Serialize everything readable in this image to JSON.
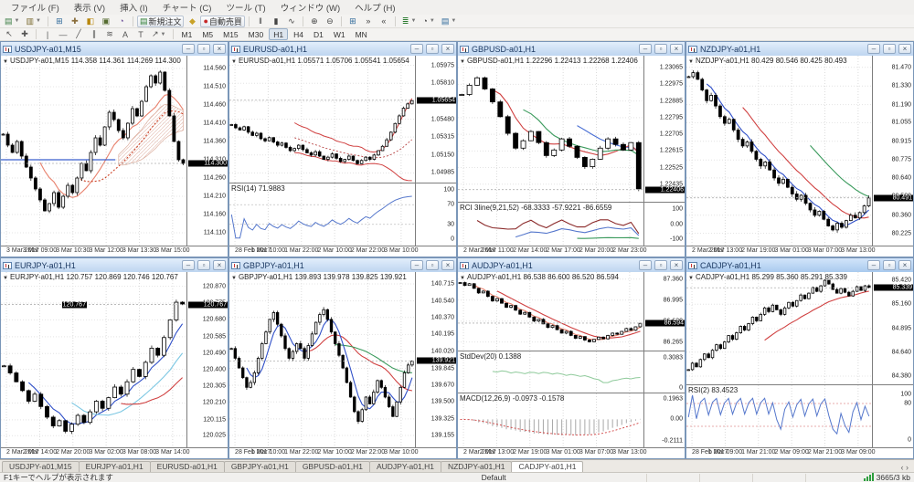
{
  "menu": [
    {
      "key": "file",
      "label": "ファイル (F)"
    },
    {
      "key": "view",
      "label": "表示 (V)"
    },
    {
      "key": "insert",
      "label": "挿入 (I)"
    },
    {
      "key": "chart",
      "label": "チャート (C)"
    },
    {
      "key": "tools",
      "label": "ツール (T)"
    },
    {
      "key": "window",
      "label": "ウィンドウ (W)"
    },
    {
      "key": "help",
      "label": "ヘルプ (H)"
    }
  ],
  "toolbar1": [
    {
      "name": "new-chart",
      "glyph": "▤",
      "dd": true,
      "color": "#3a7d44"
    },
    {
      "name": "profiles",
      "glyph": "▥",
      "dd": true,
      "color": "#7a6a2f"
    },
    {
      "sep": true
    },
    {
      "name": "market-watch",
      "glyph": "⊞",
      "color": "#2f6a9a"
    },
    {
      "name": "data-window",
      "glyph": "✚",
      "color": "#8a6d3b"
    },
    {
      "name": "navigator",
      "glyph": "◧",
      "color": "#b8860b"
    },
    {
      "name": "terminal",
      "glyph": "▣",
      "color": "#556b2f"
    },
    {
      "name": "strategy-tester",
      "glyph": "◔",
      "color": "#6b4e9a"
    },
    {
      "sep": true
    },
    {
      "name": "new-order",
      "glyph": "▤",
      "label": "新規注文",
      "color": "#2e7d32"
    },
    {
      "name": "metaeditor",
      "glyph": "◆",
      "color": "#c9a227"
    },
    {
      "name": "autotrading",
      "glyph": "●",
      "label": "自動売買",
      "color": "#c62828"
    },
    {
      "sep": true
    },
    {
      "name": "bar-chart",
      "glyph": "ǁ",
      "color": "#444"
    },
    {
      "name": "candle-chart",
      "glyph": "▮",
      "color": "#444"
    },
    {
      "name": "line-chart",
      "glyph": "∿",
      "color": "#444"
    },
    {
      "sep": true
    },
    {
      "name": "zoom-in",
      "glyph": "⊕",
      "color": "#444"
    },
    {
      "name": "zoom-out",
      "glyph": "⊖",
      "color": "#444"
    },
    {
      "sep": true
    },
    {
      "name": "tile-windows",
      "glyph": "⊞",
      "color": "#2f6a9a"
    },
    {
      "name": "auto-scroll",
      "glyph": "»",
      "color": "#444"
    },
    {
      "name": "chart-shift",
      "glyph": "«",
      "color": "#444"
    },
    {
      "sep": true
    },
    {
      "name": "indicators",
      "glyph": "≣",
      "dd": true,
      "color": "#2e7d32"
    },
    {
      "name": "periods",
      "glyph": "◔",
      "dd": true,
      "color": "#444"
    },
    {
      "name": "templates",
      "glyph": "▤",
      "dd": true,
      "color": "#2f6a9a"
    }
  ],
  "toolbar2": [
    {
      "name": "cursor",
      "glyph": "↖"
    },
    {
      "name": "crosshair",
      "glyph": "✚"
    },
    {
      "sep": true
    },
    {
      "name": "vertical-line",
      "glyph": "|"
    },
    {
      "name": "horizontal-line",
      "glyph": "—"
    },
    {
      "name": "trendline",
      "glyph": "╱"
    },
    {
      "name": "equidistant-channel",
      "glyph": "∥"
    },
    {
      "name": "fibonacci",
      "glyph": "≋"
    },
    {
      "name": "text",
      "glyph": "A"
    },
    {
      "name": "text-label",
      "glyph": "T"
    },
    {
      "name": "arrows",
      "glyph": "↗",
      "dd": true
    },
    {
      "sep": true
    }
  ],
  "timeframes": [
    "M1",
    "M5",
    "M15",
    "M30",
    "H1",
    "H4",
    "D1",
    "W1",
    "MN"
  ],
  "active_timeframe": "H1",
  "win_buttons": {
    "minimize": "–",
    "restore": "▫",
    "close": "×"
  },
  "tabs": [
    "USDJPY-a01,M15",
    "EURJPY-a01,H1",
    "EURUSD-a01,H1",
    "GBPJPY-a01,H1",
    "GBPUSD-a01,H1",
    "AUDJPY-a01,H1",
    "NZDJPY-a01,H1",
    "CADJPY-a01,H1"
  ],
  "active_tab": "CADJPY-a01,H1",
  "tab_arrows": "‹ ›",
  "statusbar": {
    "help": "F1キーでヘルプが表示されます",
    "profile": "Default",
    "traffic": "3665/3 kb"
  },
  "charts": [
    {
      "title": "USDJPY-a01,M15",
      "row": 0,
      "col": 0,
      "active": false,
      "info": "USDJPY-a01,M15  114.358 114.361 114.269 114.300",
      "current": "114.300",
      "cur_v": 114.3,
      "smin": 114.085,
      "smax": 114.585,
      "ticks": [
        "114.560",
        "114.510",
        "114.460",
        "114.410",
        "114.360",
        "114.310",
        "114.260",
        "114.210",
        "114.160",
        "114.110"
      ],
      "times": [
        "3 Mar 2017",
        "3 Mar 09:00",
        "3 Mar 10:30",
        "3 Mar 12:00",
        "3 Mar 13:30",
        "3 Mar 15:00"
      ],
      "closes": [
        114.38,
        114.35,
        114.33,
        114.36,
        114.32,
        114.29,
        114.26,
        114.23,
        114.2,
        114.17,
        114.19,
        114.22,
        114.18,
        114.21,
        114.24,
        114.22,
        114.26,
        114.3,
        114.28,
        114.33,
        114.37,
        114.35,
        114.4,
        114.44,
        114.42,
        114.39,
        114.37,
        114.41,
        114.45,
        114.43,
        114.47,
        114.51,
        114.54,
        114.52,
        114.55,
        114.5,
        114.43,
        114.36,
        114.31,
        114.3
      ],
      "mas": [
        {
          "p": 9,
          "c": "#e8826e"
        },
        {
          "p": 17,
          "c": "#cc4125",
          "d": 1
        }
      ],
      "cloud": [
        13,
        26
      ],
      "hline": {
        "v": 114.31,
        "c": "#3a5fcd",
        "to": 0.62
      },
      "panes": [
        {
          "type": "price",
          "h": 1.0
        }
      ]
    },
    {
      "title": "EURUSD-a01,H1",
      "row": 0,
      "col": 1,
      "active": false,
      "info": "EURUSD-a01,H1  1.05571 1.05706 1.05541 1.05654",
      "current": "1.05654",
      "cur_v": 1.05654,
      "smin": 1.0493,
      "smax": 1.0603,
      "ticks": [
        "1.05975",
        "1.05810",
        "1.05645",
        "1.05480",
        "1.05315",
        "1.05150",
        "1.04985"
      ],
      "times": [
        "28 Feb 2017",
        "1 Mar 10:00",
        "1 Mar 22:00",
        "2 Mar 10:00",
        "2 Mar 22:00",
        "3 Mar 10:00"
      ],
      "closes": [
        1.0543,
        1.054,
        1.0538,
        1.0541,
        1.0536,
        1.0533,
        1.0535,
        1.053,
        1.0528,
        1.0531,
        1.0527,
        1.0524,
        1.0526,
        1.0522,
        1.0519,
        1.0521,
        1.0524,
        1.052,
        1.0517,
        1.0515,
        1.0518,
        1.0514,
        1.0511,
        1.0513,
        1.0516,
        1.0512,
        1.0509,
        1.0511,
        1.0514,
        1.051,
        1.0507,
        1.051,
        1.0513,
        1.0511,
        1.0515,
        1.0519,
        1.0523,
        1.0529,
        1.0536,
        1.0544,
        1.0551,
        1.0558,
        1.0562,
        1.0565
      ],
      "mas": [],
      "bb": {
        "p": 16,
        "k": 1.9,
        "c": "#d04040"
      },
      "panes": [
        {
          "type": "price",
          "h": 0.67
        },
        {
          "type": "rsi",
          "h": 0.33,
          "p": 10,
          "label": "RSI(14) 71.9883",
          "smin": -6,
          "smax": 106,
          "lc": "#5577cc",
          "levels": [
            70,
            30
          ],
          "ticks": [
            {
              "v": 100,
              "t": "100"
            },
            {
              "v": 70,
              "t": "70"
            },
            {
              "v": 30,
              "t": "30"
            },
            {
              "v": 0,
              "t": "0"
            }
          ]
        }
      ]
    },
    {
      "title": "GBPUSD-a01,H1",
      "row": 0,
      "col": 2,
      "active": false,
      "info": "GBPUSD-a01,H1  1.22296 1.22413 1.22268 1.22406",
      "current": "1.22406",
      "cur_v": 1.22406,
      "smin": 1.2236,
      "smax": 1.2311,
      "ticks": [
        "1.23065",
        "1.22975",
        "1.22885",
        "1.22795",
        "1.22705",
        "1.22615",
        "1.22525",
        "1.22435"
      ],
      "times": [
        "2 Mar 2017",
        "2 Mar 11:00",
        "2 Mar 14:00",
        "2 Mar 17:00",
        "2 Mar 20:00",
        "2 Mar 23:00"
      ],
      "closes": [
        1.2292,
        1.2297,
        1.2301,
        1.2295,
        1.2288,
        1.228,
        1.2271,
        1.2263,
        1.2267,
        1.2272,
        1.2266,
        1.2259,
        1.2262,
        1.2268,
        1.2264,
        1.2258,
        1.2253,
        1.2257,
        1.2263,
        1.2268,
        1.2265,
        1.2262,
        1.2266,
        1.2241
      ],
      "mas": [
        {
          "p": 16,
          "c": "#4a6fd4"
        },
        {
          "p": 5,
          "c": "#d04040"
        },
        {
          "p": 9,
          "c": "#3a9a5c"
        }
      ],
      "panes": [
        {
          "type": "price",
          "h": 0.77
        },
        {
          "type": "rci",
          "h": 0.23,
          "label": "RCI 3line(9,21,52) -68.3333 -57.9221 -86.6559",
          "smin": -118,
          "smax": 118,
          "lines": [
            {
              "p": 3,
              "c": "#8b2a2a",
              "w": 1.1,
              "o": 5
            },
            {
              "p": 8,
              "c": "#5577cc",
              "w": 0.55,
              "o": -35
            },
            {
              "p": 16,
              "c": "#3a9a5c",
              "w": 0.06,
              "o": -90
            }
          ],
          "ticks": [
            {
              "v": 100,
              "t": "100"
            },
            {
              "v": 0,
              "t": "0.00"
            },
            {
              "v": -100,
              "t": "-100"
            }
          ]
        }
      ]
    },
    {
      "title": "NZDJPY-a01,H1",
      "row": 0,
      "col": 3,
      "active": false,
      "info": "NZDJPY-a01,H1  80.429 80.546 80.425 80.493",
      "current": "80.491",
      "cur_v": 80.491,
      "smin": 80.16,
      "smax": 81.53,
      "ticks": [
        "81.470",
        "81.330",
        "81.190",
        "81.055",
        "80.915",
        "80.775",
        "80.640",
        "80.500",
        "80.360",
        "80.225"
      ],
      "times": [
        "2 Mar 2017",
        "2 Mar 13:00",
        "2 Mar 19:00",
        "3 Mar 01:00",
        "3 Mar 07:00",
        "3 Mar 13:00"
      ],
      "closes": [
        81.4,
        81.43,
        81.38,
        81.3,
        81.22,
        81.26,
        81.18,
        81.1,
        81.05,
        81.08,
        81.0,
        80.93,
        80.88,
        80.91,
        80.84,
        80.78,
        80.73,
        80.76,
        80.7,
        80.64,
        80.6,
        80.63,
        80.57,
        80.52,
        80.48,
        80.51,
        80.45,
        80.4,
        80.36,
        80.39,
        80.33,
        80.28,
        80.25,
        80.3,
        80.27,
        80.32,
        80.36,
        80.34,
        80.38,
        80.43,
        80.49
      ],
      "mas": [
        {
          "p": 28,
          "c": "#3a9a5c"
        },
        {
          "p": 13,
          "c": "#d04040"
        },
        {
          "p": 5,
          "c": "#3050c8"
        }
      ],
      "panes": [
        {
          "type": "price",
          "h": 1.0
        }
      ]
    },
    {
      "title": "EURJPY-a01,H1",
      "row": 1,
      "col": 0,
      "active": false,
      "info": "EURJPY-a01,H1  120.757 120.869 120.746 120.767",
      "current": "120.767",
      "cur_v": 120.767,
      "smin": 119.98,
      "smax": 120.93,
      "ticks": [
        "120.870",
        "120.775",
        "120.680",
        "120.585",
        "120.490",
        "120.400",
        "120.305",
        "120.210",
        "120.115",
        "120.025"
      ],
      "times": [
        "2 Mar 2017",
        "2 Mar 14:00",
        "2 Mar 20:00",
        "3 Mar 02:00",
        "3 Mar 08:00",
        "3 Mar 14:00"
      ],
      "closes": [
        120.42,
        120.38,
        120.33,
        120.28,
        120.22,
        120.26,
        120.19,
        120.13,
        120.08,
        120.11,
        120.05,
        120.09,
        120.14,
        120.1,
        120.16,
        120.22,
        120.18,
        120.24,
        120.3,
        120.26,
        120.33,
        120.4,
        120.36,
        120.44,
        120.52,
        120.48,
        120.58,
        120.68,
        120.78,
        120.77
      ],
      "mas": [
        {
          "p": 5,
          "c": "#3050c8"
        },
        {
          "p": 12,
          "c": "#7ec8e3"
        },
        {
          "p": 20,
          "c": "#d04040"
        }
      ],
      "tag": {
        "v": 120.767,
        "x": 0.33,
        "t": "120.767"
      },
      "panes": [
        {
          "type": "price",
          "h": 1.0
        }
      ]
    },
    {
      "title": "GBPJPY-a01,H1",
      "row": 1,
      "col": 1,
      "active": false,
      "info": "GBPJPY-a01,H1  139.893 139.978 139.825 139.921",
      "current": "139.921",
      "cur_v": 139.921,
      "smin": 139.07,
      "smax": 140.8,
      "ticks": [
        "140.715",
        "140.540",
        "140.370",
        "140.195",
        "140.020",
        "139.845",
        "139.670",
        "139.500",
        "139.325",
        "139.155"
      ],
      "times": [
        "28 Feb 2017",
        "1 Mar 10:00",
        "1 Mar 22:00",
        "2 Mar 10:00",
        "2 Mar 22:00",
        "3 Mar 10:00"
      ],
      "closes": [
        140.05,
        139.95,
        139.85,
        139.75,
        139.65,
        139.7,
        139.8,
        139.95,
        140.1,
        140.22,
        140.35,
        140.42,
        140.3,
        140.18,
        140.05,
        139.95,
        140.02,
        140.1,
        140.05,
        139.95,
        140.08,
        140.2,
        140.32,
        140.4,
        140.45,
        140.35,
        140.22,
        140.1,
        139.98,
        139.85,
        139.7,
        139.55,
        139.4,
        139.3,
        139.42,
        139.55,
        139.48,
        139.6,
        139.72,
        139.65,
        139.55,
        139.45,
        139.35,
        139.5,
        139.65,
        139.8,
        139.88,
        139.92
      ],
      "mas": [
        {
          "p": 20,
          "c": "#d04040"
        },
        {
          "p": 28,
          "c": "#3a9a5c"
        },
        {
          "p": 5,
          "c": "#3050c8"
        }
      ],
      "panes": [
        {
          "type": "price",
          "h": 1.0
        }
      ]
    },
    {
      "title": "AUDJPY-a01,H1",
      "row": 1,
      "col": 2,
      "active": false,
      "info": "AUDJPY-a01,H1  86.538 86.600 86.520 86.594",
      "current": "86.594",
      "cur_v": 86.594,
      "smin": 86.18,
      "smax": 87.42,
      "ticks": [
        "87.360",
        "86.995",
        "86.630",
        "86.265"
      ],
      "times": [
        "2 Mar 2017",
        "2 Mar 13:00",
        "2 Mar 19:00",
        "3 Mar 01:00",
        "3 Mar 07:00",
        "3 Mar 13:00"
      ],
      "closes": [
        87.3,
        87.25,
        87.28,
        87.2,
        87.12,
        87.15,
        87.06,
        86.98,
        87.02,
        86.94,
        86.87,
        86.9,
        86.82,
        86.75,
        86.78,
        86.7,
        86.63,
        86.66,
        86.58,
        86.52,
        86.55,
        86.48,
        86.42,
        86.45,
        86.38,
        86.33,
        86.36,
        86.3,
        86.27,
        86.31,
        86.35,
        86.32,
        86.38,
        86.42,
        86.4,
        86.45,
        86.5,
        86.47,
        86.53,
        86.59
      ],
      "mas": [
        {
          "p": 9,
          "c": "#d04040"
        },
        {
          "p": 4,
          "c": "#e8826e"
        }
      ],
      "panes": [
        {
          "type": "price",
          "h": 0.45
        },
        {
          "type": "stddev",
          "h": 0.24,
          "label": "StdDev(20) 0.1388",
          "p": 8,
          "k": 1.6,
          "smin": -0.012,
          "smax": 0.335,
          "lc": "#8fca9b",
          "ticks": [
            {
              "v": 0.3083,
              "t": "0.3083"
            },
            {
              "v": 0,
              "t": "0"
            }
          ]
        },
        {
          "type": "macd",
          "h": 0.31,
          "label": "MACD(12,26,9) -0.0973 -0.1578",
          "smin": -0.235,
          "smax": 0.215,
          "ticks": [
            {
              "v": 0.1963,
              "t": "0.1963"
            },
            {
              "v": 0,
              "t": "0.00"
            },
            {
              "v": -0.2111,
              "t": "-0.2111"
            }
          ]
        }
      ]
    },
    {
      "title": "CADJPY-a01,H1",
      "row": 1,
      "col": 3,
      "active": true,
      "info": "CADJPY-a01,H1  85.299 85.360 85.291 85.339",
      "current": "85.339",
      "cur_v": 85.339,
      "smin": 84.33,
      "smax": 85.47,
      "ticks": [
        "85.420",
        "85.160",
        "84.895",
        "84.640",
        "84.380"
      ],
      "times": [
        "28 Feb 2017",
        "1 Mar 09:00",
        "1 Mar 21:00",
        "2 Mar 09:00",
        "2 Mar 21:00",
        "3 Mar 09:00"
      ],
      "closes": [
        84.45,
        84.52,
        84.48,
        84.56,
        84.62,
        84.58,
        84.66,
        84.72,
        84.68,
        84.75,
        84.82,
        84.78,
        84.85,
        84.92,
        84.88,
        84.95,
        85.02,
        84.98,
        85.05,
        85.12,
        85.08,
        85.15,
        85.1,
        85.05,
        85.12,
        85.18,
        85.14,
        85.2,
        85.26,
        85.22,
        85.28,
        85.34,
        85.3,
        85.36,
        85.42,
        85.38,
        85.32,
        85.28,
        85.33,
        85.29,
        85.25,
        85.3,
        85.35,
        85.31,
        85.36,
        85.34
      ],
      "mas": [
        {
          "p": 20,
          "c": "#d04040"
        }
      ],
      "panes": [
        {
          "type": "price",
          "h": 0.64
        },
        {
          "type": "rsi",
          "h": 0.36,
          "p": 2,
          "label": "RSI(2) 83.4523",
          "smin": -8,
          "smax": 112,
          "lc": "#5577cc",
          "levels": [
            80,
            30
          ],
          "lvlc": "#e09090",
          "ticks": [
            {
              "v": 100,
              "t": "100"
            },
            {
              "v": 80,
              "t": "80"
            },
            {
              "v": 0,
              "t": "0"
            }
          ]
        }
      ]
    }
  ]
}
